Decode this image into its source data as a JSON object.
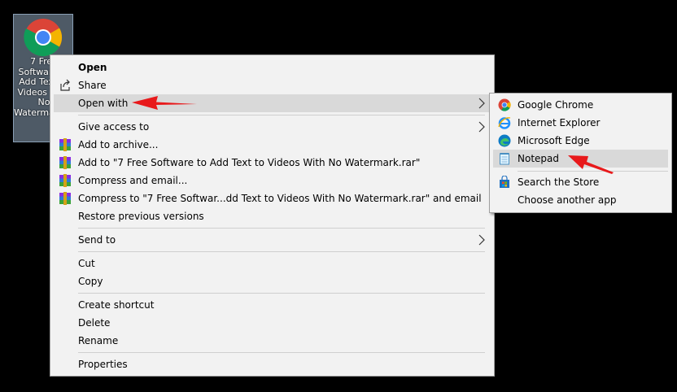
{
  "desktop": {
    "file_icon_label": "7 Free Software to Add Text to Videos With No Watermark.html"
  },
  "context_menu": {
    "items": [
      {
        "label": "Open"
      },
      {
        "label": "Share"
      },
      {
        "label": "Open with"
      },
      {
        "label": "Give access to"
      },
      {
        "label": "Add to archive..."
      },
      {
        "label": "Add to \"7 Free Software to Add Text to Videos With No Watermark.rar\""
      },
      {
        "label": "Compress and email..."
      },
      {
        "label": "Compress to \"7 Free Softwar...dd Text to Videos With No Watermark.rar\" and email"
      },
      {
        "label": "Restore previous versions"
      },
      {
        "label": "Send to"
      },
      {
        "label": "Cut"
      },
      {
        "label": "Copy"
      },
      {
        "label": "Create shortcut"
      },
      {
        "label": "Delete"
      },
      {
        "label": "Rename"
      },
      {
        "label": "Properties"
      }
    ]
  },
  "open_with_submenu": {
    "items": [
      {
        "label": "Google Chrome"
      },
      {
        "label": "Internet Explorer"
      },
      {
        "label": "Microsoft Edge"
      },
      {
        "label": "Notepad"
      },
      {
        "label": "Search the Store"
      },
      {
        "label": "Choose another app"
      }
    ]
  },
  "colors": {
    "menu_bg": "#f2f2f2",
    "highlight": "#d9d9d9",
    "annotation_arrow": "#e8191b"
  },
  "icons": [
    "chrome-icon",
    "share-icon",
    "winrar-icon",
    "ie-icon",
    "edge-icon",
    "notepad-icon",
    "store-icon",
    "chevron-right-icon",
    "red-arrow-icon"
  ]
}
